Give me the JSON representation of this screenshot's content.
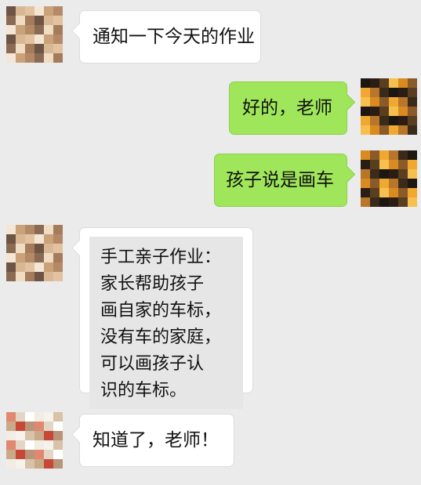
{
  "chat": {
    "messages": [
      {
        "side": "left",
        "text": "通知一下今天的作业"
      },
      {
        "side": "right",
        "text": "好的，老师"
      },
      {
        "side": "right",
        "text": "孩子说是画车"
      },
      {
        "side": "left",
        "text": "手工亲子作业：\n家长帮助孩子\n画自家的车标，\n没有车的家庭，\n可以画孩子认\n识的车标。"
      },
      {
        "side": "left",
        "text": "知道了，老师！"
      }
    ]
  }
}
